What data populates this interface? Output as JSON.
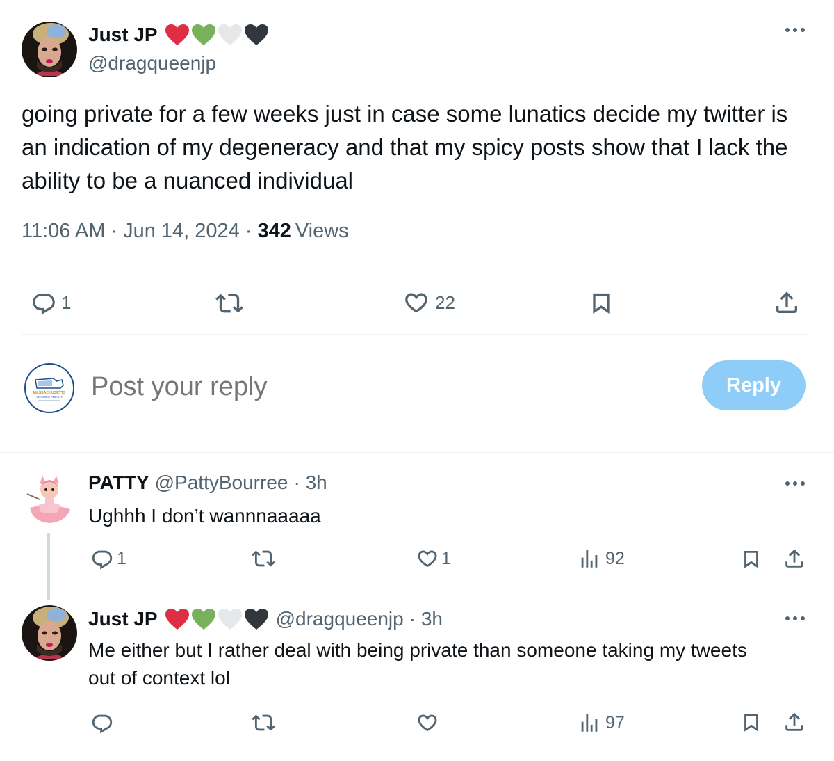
{
  "main_tweet": {
    "author_name": "Just JP",
    "author_handle": "@dragqueenjp",
    "text": "going private for a few weeks just in case some lunatics decide my twitter is an indication of my degeneracy and that my spicy posts show that I lack the ability to be a nuanced individual",
    "time": "11:06 AM",
    "date": "Jun 14, 2024",
    "separator": "·",
    "views_count": "342",
    "views_label": "Views",
    "replies": "1",
    "likes": "22"
  },
  "reply_box": {
    "placeholder": "Post your reply",
    "button_label": "Reply",
    "avatar_text": "MASSACHUSETTS INFORMED PARENTS"
  },
  "replies": [
    {
      "author_name": "PATTY",
      "author_handle": "@PattyBourree",
      "time": "· 3h",
      "text": "Ughhh I don’t wannnaaaaa",
      "replies": "1",
      "likes": "1",
      "views": "92"
    },
    {
      "author_name": "Just JP",
      "author_handle": "@dragqueenjp",
      "time": "· 3h",
      "text": "Me either but I rather deal with being private than someone taking my tweets out of context lol",
      "views": "97"
    }
  ],
  "colors": {
    "accent_disabled": "#8ecdf8",
    "muted_text": "#536471",
    "divider": "#eff3f4",
    "heart_red": "#dd2e44",
    "heart_green": "#78b159",
    "heart_white": "#e6e7e8",
    "heart_black": "#31373d"
  },
  "icons": [
    "more-icon",
    "reply-icon",
    "retweet-icon",
    "like-icon",
    "bookmark-icon",
    "share-icon",
    "views-icon"
  ]
}
